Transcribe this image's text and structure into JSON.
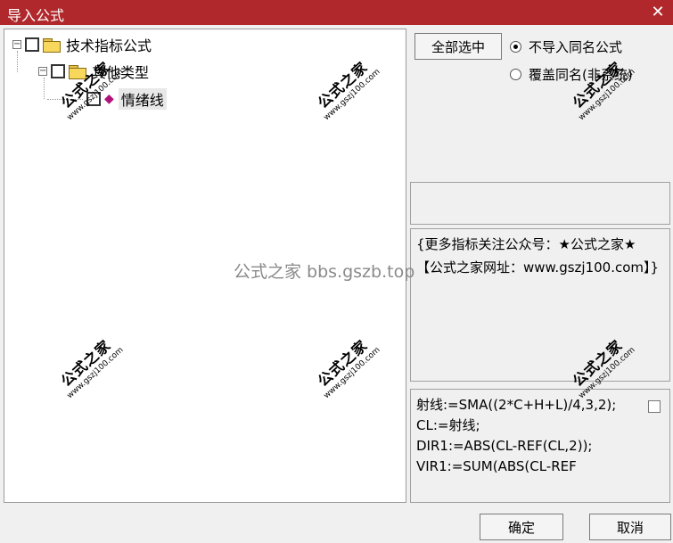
{
  "window": {
    "title": "导入公式",
    "close_glyph": "✕"
  },
  "tree": {
    "root": {
      "label": "技术指标公式"
    },
    "child": {
      "label": "其他类型"
    },
    "leaf": {
      "label": "情绪线"
    }
  },
  "options": {
    "select_all_label": "全部选中",
    "radio_no_import_label": "不导入同名公式",
    "radio_overwrite_label": "覆盖同名(非系统)"
  },
  "description": "{更多指标关注公众号：★公式之家★ 【公式之家网址：www.gszj100.com】}",
  "code_preview": "射线:=SMA((2*C+H+L)/4,3,2);\nCL:=射线;\nDIR1:=ABS(CL-REF(CL,2));\nVIR1:=SUM(ABS(CL-REF",
  "watermarks": {
    "brand": "公式之家",
    "url": "www.gszj100.com",
    "center": "公式之家 bbs.gszb.top"
  },
  "buttons": {
    "ok_label": "确定",
    "cancel_label": "取消"
  }
}
